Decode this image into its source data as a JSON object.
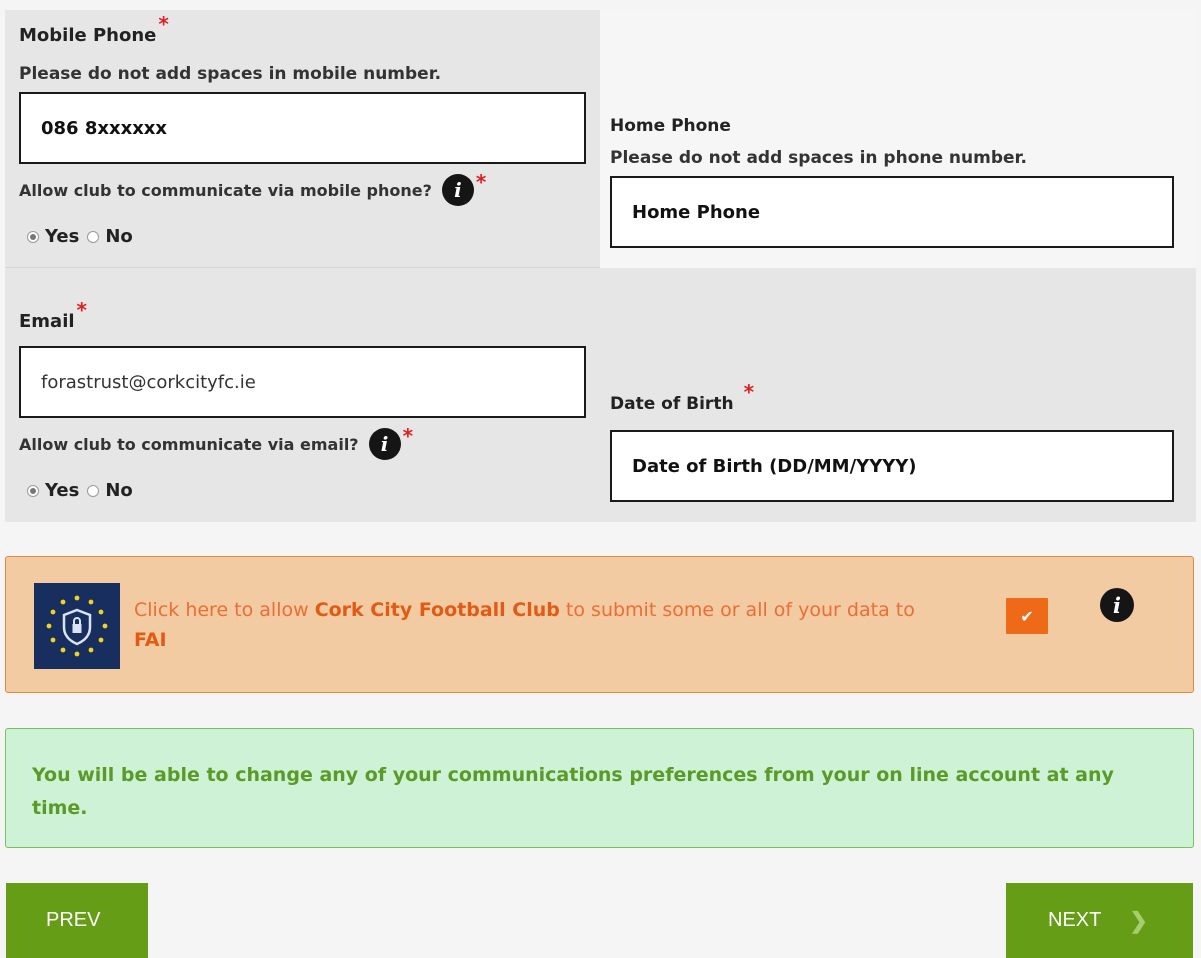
{
  "mobile": {
    "label": "Mobile Phone",
    "hint": "Please do not add spaces in mobile number.",
    "value": "086 8xxxxxx",
    "consent_question": "Allow club to communicate via mobile phone?",
    "options": [
      "Yes",
      "No"
    ],
    "selected": "Yes"
  },
  "home_phone": {
    "label": "Home Phone",
    "hint": "Please do not add spaces in phone number.",
    "placeholder": "Home Phone"
  },
  "email": {
    "label": "Email",
    "value": "forastrust@corkcityfc.ie",
    "consent_question": "Allow club to communicate via email?",
    "options": [
      "Yes",
      "No"
    ],
    "selected": "Yes"
  },
  "dob": {
    "label": "Date of Birth",
    "placeholder": "Date of Birth (DD/MM/YYYY)"
  },
  "required_mark": "*",
  "info_glyph": "i",
  "data_consent": {
    "text_before": "Click here to allow ",
    "club": "Cork City Football Club",
    "text_middle": " to submit some or all of your data to ",
    "org": "FAI",
    "checked": true,
    "check_glyph": "✔"
  },
  "notice": "You will be able to change any of your communications preferences from your on line account at any time.",
  "nav": {
    "prev": "PREV",
    "next": "NEXT",
    "next_glyph": "❯"
  },
  "colors": {
    "accent_green": "#669d17",
    "consent_orange": "#ef6a18",
    "required_red": "#e02020",
    "notice_green_text": "#5b9a26"
  }
}
